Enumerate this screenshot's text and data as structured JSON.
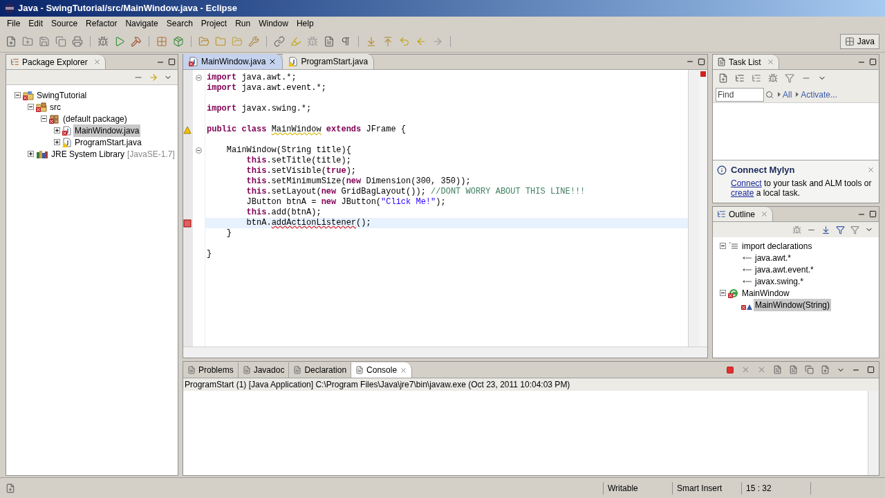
{
  "window": {
    "title": "Java - SwingTutorial/src/MainWindow.java - Eclipse"
  },
  "menu": [
    "File",
    "Edit",
    "Source",
    "Refactor",
    "Navigate",
    "Search",
    "Project",
    "Run",
    "Window",
    "Help"
  ],
  "perspective": {
    "label": "Java"
  },
  "package_explorer": {
    "title": "Package Explorer",
    "tree": [
      {
        "label": "SwingTutorial",
        "kind": "project",
        "error": true,
        "warning": false,
        "expanded": true,
        "selected": false,
        "children": [
          {
            "label": "src",
            "kind": "source-folder",
            "error": true,
            "warning": false,
            "expanded": true,
            "selected": false,
            "children": [
              {
                "label": "(default package)",
                "kind": "package",
                "error": true,
                "warning": false,
                "expanded": true,
                "selected": false,
                "children": [
                  {
                    "label": "MainWindow.java",
                    "kind": "java-file",
                    "error": true,
                    "warning": false,
                    "expanded": false,
                    "selected": true
                  },
                  {
                    "label": "ProgramStart.java",
                    "kind": "java-file",
                    "error": false,
                    "warning": true,
                    "expanded": false,
                    "selected": false
                  }
                ]
              }
            ]
          },
          {
            "label": "JRE System Library",
            "note": "[JavaSE-1.7]",
            "kind": "library",
            "error": false,
            "warning": false,
            "expanded": false,
            "selected": false
          }
        ]
      }
    ]
  },
  "editor": {
    "tabs": [
      {
        "label": "MainWindow.java",
        "error": true,
        "warning": false,
        "selected": true
      },
      {
        "label": "ProgramStart.java",
        "error": false,
        "warning": true,
        "selected": false
      }
    ],
    "lines": [
      {
        "fold": true,
        "current": false,
        "error": false,
        "warning": false,
        "segments": [
          {
            "kind": "kw",
            "t": "import"
          },
          {
            "kind": "plain",
            "t": " java.awt.*;"
          }
        ]
      },
      {
        "fold": false,
        "current": false,
        "error": false,
        "warning": false,
        "segments": [
          {
            "kind": "kw",
            "t": "import"
          },
          {
            "kind": "plain",
            "t": " java.awt.event.*;"
          }
        ]
      },
      {
        "fold": false,
        "current": false,
        "error": false,
        "warning": false
      },
      {
        "fold": false,
        "current": false,
        "error": false,
        "warning": false,
        "segments": [
          {
            "kind": "kw",
            "t": "import"
          },
          {
            "kind": "plain",
            "t": " javax.swing.*;"
          }
        ]
      },
      {
        "fold": false,
        "current": false,
        "error": false,
        "warning": false
      },
      {
        "fold": false,
        "current": false,
        "error": false,
        "warning": true,
        "segments": [
          {
            "kind": "kw",
            "t": "public class "
          },
          {
            "kind": "warn",
            "t": "MainWindow"
          },
          {
            "kind": "kw",
            "t": " extends"
          },
          {
            "kind": "plain",
            "t": " JFrame {"
          }
        ]
      },
      {
        "fold": false,
        "current": false,
        "error": false,
        "warning": false
      },
      {
        "fold": true,
        "current": false,
        "error": false,
        "warning": false,
        "segments": [
          {
            "kind": "plain",
            "t": "    MainWindow(String title){"
          }
        ]
      },
      {
        "fold": false,
        "current": false,
        "error": false,
        "warning": false,
        "segments": [
          {
            "kind": "kw",
            "t": "        this"
          },
          {
            "kind": "plain",
            "t": ".setTitle(title);"
          }
        ]
      },
      {
        "fold": false,
        "current": false,
        "error": false,
        "warning": false,
        "segments": [
          {
            "kind": "kw",
            "t": "        this"
          },
          {
            "kind": "plain",
            "t": ".setVisible("
          },
          {
            "kind": "kw",
            "t": "true"
          },
          {
            "kind": "plain",
            "t": ");"
          }
        ]
      },
      {
        "fold": false,
        "current": false,
        "error": false,
        "warning": false,
        "segments": [
          {
            "kind": "kw",
            "t": "        this"
          },
          {
            "kind": "plain",
            "t": ".setMinimumSize("
          },
          {
            "kind": "kw",
            "t": "new"
          },
          {
            "kind": "plain",
            "t": " Dimension(300, 350));"
          }
        ]
      },
      {
        "fold": false,
        "current": false,
        "error": false,
        "warning": false,
        "segments": [
          {
            "kind": "kw",
            "t": "        this"
          },
          {
            "kind": "plain",
            "t": ".setLayout("
          },
          {
            "kind": "kw",
            "t": "new"
          },
          {
            "kind": "plain",
            "t": " GridBagLayout()); "
          },
          {
            "kind": "comment",
            "t": "//DONT WORRY ABOUT THIS LINE!!!"
          }
        ]
      },
      {
        "fold": false,
        "current": false,
        "error": false,
        "warning": false,
        "segments": [
          {
            "kind": "plain",
            "t": "        JButton btnA = "
          },
          {
            "kind": "kw",
            "t": "new"
          },
          {
            "kind": "plain",
            "t": " JButton("
          },
          {
            "kind": "string",
            "t": "\"Click Me!\""
          },
          {
            "kind": "plain",
            "t": ");"
          }
        ]
      },
      {
        "fold": false,
        "current": false,
        "error": false,
        "warning": false,
        "segments": [
          {
            "kind": "kw",
            "t": "        this"
          },
          {
            "kind": "plain",
            "t": ".add(btnA);"
          }
        ]
      },
      {
        "fold": false,
        "current": true,
        "error": true,
        "warning": false,
        "segments": [
          {
            "kind": "plain",
            "t": "        btnA."
          },
          {
            "kind": "err",
            "t": "addActionListener"
          },
          {
            "kind": "plain",
            "t": "();"
          }
        ]
      },
      {
        "fold": false,
        "current": false,
        "error": false,
        "warning": false,
        "segments": [
          {
            "kind": "plain",
            "t": "    }"
          }
        ]
      },
      {
        "fold": false,
        "current": false,
        "error": false,
        "warning": false
      },
      {
        "fold": false,
        "current": false,
        "error": false,
        "warning": false,
        "segments": [
          {
            "kind": "plain",
            "t": "}"
          }
        ]
      }
    ]
  },
  "task_list": {
    "title": "Task List",
    "find": {
      "placeholder": "Find"
    },
    "filters": [
      "All",
      "Activate..."
    ]
  },
  "mylyn": {
    "title": "Connect Mylyn",
    "text_links": [
      "Connect",
      "create"
    ],
    "text_parts": [
      " to your task and ALM tools or ",
      " a local task."
    ]
  },
  "outline": {
    "title": "Outline",
    "tree": [
      {
        "label": "import declarations",
        "kind": "imports",
        "error": false,
        "warning": false,
        "expanded": true,
        "selected": false,
        "children": [
          {
            "label": "java.awt.*",
            "kind": "import",
            "error": false,
            "warning": false,
            "selected": false
          },
          {
            "label": "java.awt.event.*",
            "kind": "import",
            "error": false,
            "warning": false,
            "selected": false
          },
          {
            "label": "javax.swing.*",
            "kind": "import",
            "error": false,
            "warning": false,
            "selected": false
          }
        ]
      },
      {
        "label": "MainWindow",
        "kind": "class",
        "error": true,
        "warning": false,
        "expanded": true,
        "selected": false,
        "children": [
          {
            "label": "MainWindow(String)",
            "kind": "constructor",
            "error": true,
            "warning": false,
            "selected": true
          }
        ]
      }
    ]
  },
  "bottom": {
    "tabs": [
      {
        "label": "Problems",
        "selected": false
      },
      {
        "label": "Javadoc",
        "selected": false
      },
      {
        "label": "Declaration",
        "selected": false
      },
      {
        "label": "Console",
        "selected": true
      }
    ],
    "console_header": "ProgramStart (1) [Java Application] C:\\Program Files\\Java\\jre7\\bin\\javaw.exe (Oct 23, 2011 10:04:03 PM)"
  },
  "status_bar": [
    "Writable",
    "Smart Insert",
    "15 : 32"
  ]
}
